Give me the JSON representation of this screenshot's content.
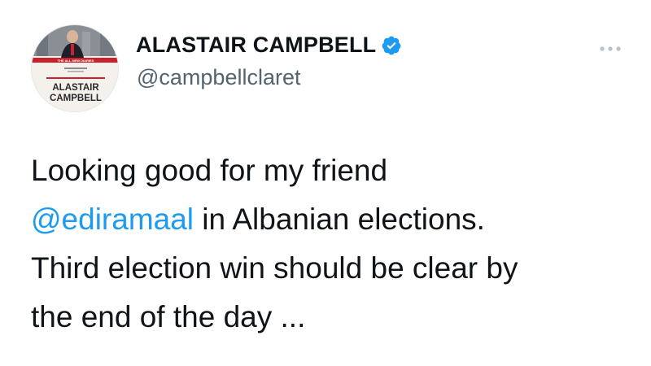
{
  "user": {
    "display_name": "ALASTAIR CAMPBELL",
    "handle": "@campbellclaret",
    "verified": true,
    "avatar_alt_text_lines": [
      "ALASTAIR",
      "CAMPBELL"
    ]
  },
  "tweet": {
    "line1": "Looking good for my friend",
    "mention": "@ediramaal",
    "line2_rest": " in Albanian elections.",
    "line3": "Third election win should be clear by",
    "line4": "the end of the day ..."
  },
  "colors": {
    "text": "#0f1419",
    "secondary": "#536471",
    "accent": "#1d9bf0",
    "verified_badge": "#1d9bf0"
  },
  "icons": {
    "verified": "verified-badge-icon",
    "more": "more-options-icon"
  }
}
